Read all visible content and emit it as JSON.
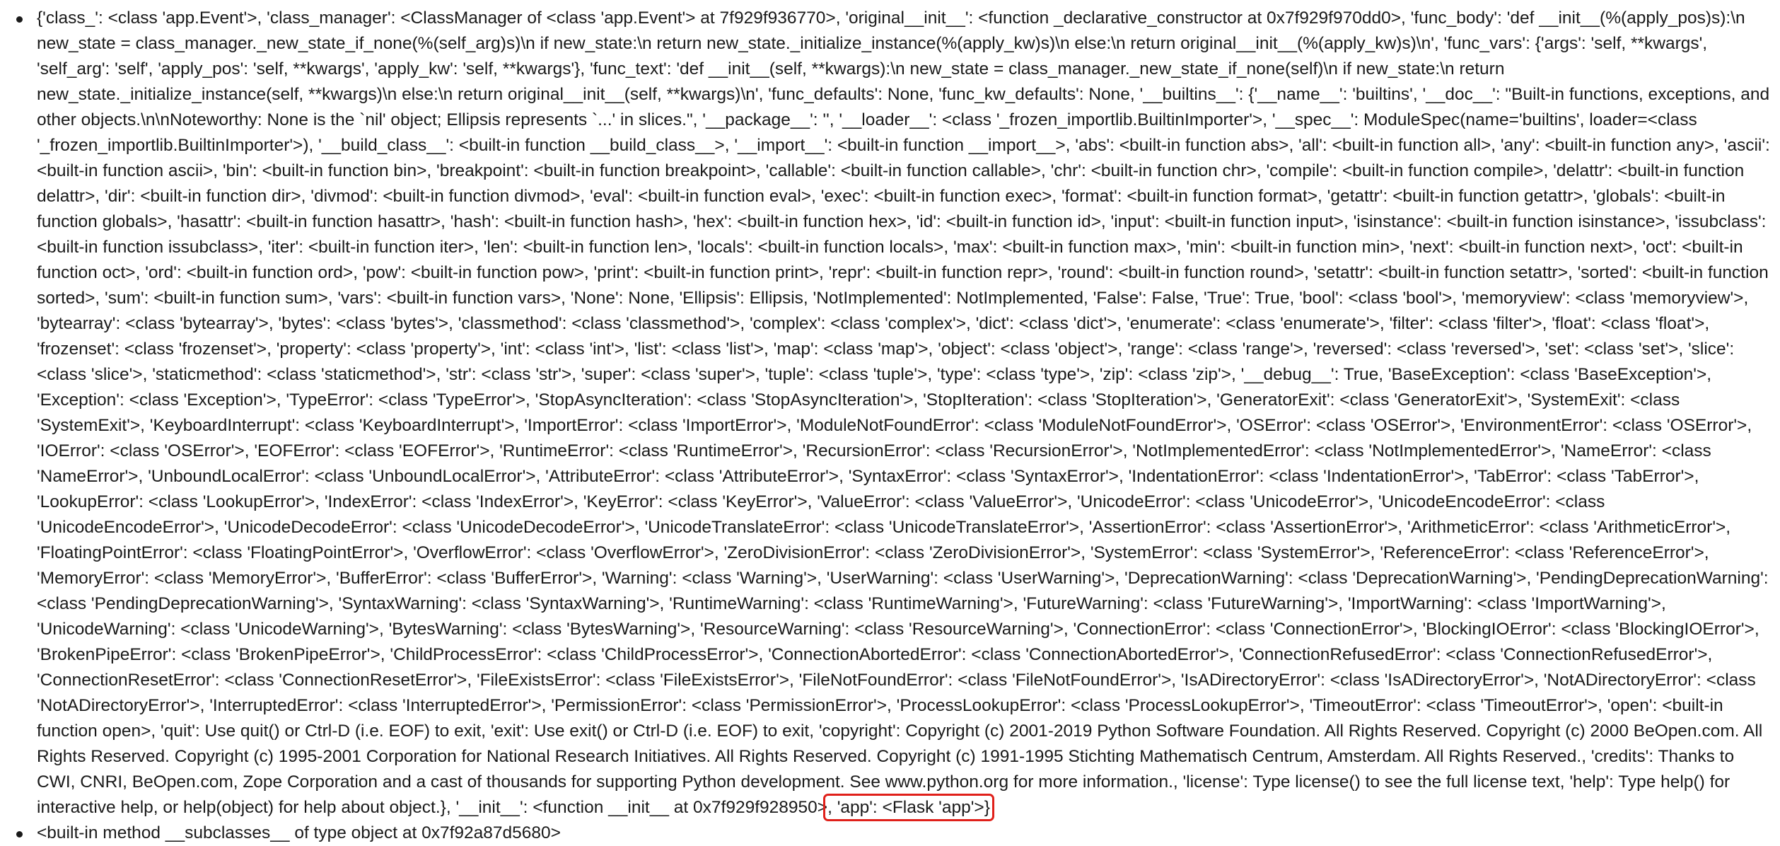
{
  "list": {
    "prev_item_text": "",
    "main_item_text": "{'class_': <class 'app.Event'>, 'class_manager': <ClassManager of <class 'app.Event'> at 7f929f936770>, 'original__init__': <function _declarative_constructor at 0x7f929f970dd0>, 'func_body': 'def __init__(%(apply_pos)s):\\n new_state = class_manager._new_state_if_none(%(self_arg)s)\\n if new_state:\\n return new_state._initialize_instance(%(apply_kw)s)\\n else:\\n return original__init__(%(apply_kw)s)\\n', 'func_vars': {'args': 'self, **kwargs', 'self_arg': 'self', 'apply_pos': 'self, **kwargs', 'apply_kw': 'self, **kwargs'}, 'func_text': 'def __init__(self, **kwargs):\\n new_state = class_manager._new_state_if_none(self)\\n if new_state:\\n return new_state._initialize_instance(self, **kwargs)\\n else:\\n return original__init__(self, **kwargs)\\n', 'func_defaults': None, 'func_kw_defaults': None, '__builtins__': {'__name__': 'builtins', '__doc__': \"Built-in functions, exceptions, and other objects.\\n\\nNoteworthy: None is the `nil' object; Ellipsis represents `...' in slices.\", '__package__': '', '__loader__': <class '_frozen_importlib.BuiltinImporter'>, '__spec__': ModuleSpec(name='builtins', loader=<class '_frozen_importlib.BuiltinImporter'>), '__build_class__': <built-in function __build_class__>, '__import__': <built-in function __import__>, 'abs': <built-in function abs>, 'all': <built-in function all>, 'any': <built-in function any>, 'ascii': <built-in function ascii>, 'bin': <built-in function bin>, 'breakpoint': <built-in function breakpoint>, 'callable': <built-in function callable>, 'chr': <built-in function chr>, 'compile': <built-in function compile>, 'delattr': <built-in function delattr>, 'dir': <built-in function dir>, 'divmod': <built-in function divmod>, 'eval': <built-in function eval>, 'exec': <built-in function exec>, 'format': <built-in function format>, 'getattr': <built-in function getattr>, 'globals': <built-in function globals>, 'hasattr': <built-in function hasattr>, 'hash': <built-in function hash>, 'hex': <built-in function hex>, 'id': <built-in function id>, 'input': <built-in function input>, 'isinstance': <built-in function isinstance>, 'issubclass': <built-in function issubclass>, 'iter': <built-in function iter>, 'len': <built-in function len>, 'locals': <built-in function locals>, 'max': <built-in function max>, 'min': <built-in function min>, 'next': <built-in function next>, 'oct': <built-in function oct>, 'ord': <built-in function ord>, 'pow': <built-in function pow>, 'print': <built-in function print>, 'repr': <built-in function repr>, 'round': <built-in function round>, 'setattr': <built-in function setattr>, 'sorted': <built-in function sorted>, 'sum': <built-in function sum>, 'vars': <built-in function vars>, 'None': None, 'Ellipsis': Ellipsis, 'NotImplemented': NotImplemented, 'False': False, 'True': True, 'bool': <class 'bool'>, 'memoryview': <class 'memoryview'>, 'bytearray': <class 'bytearray'>, 'bytes': <class 'bytes'>, 'classmethod': <class 'classmethod'>, 'complex': <class 'complex'>, 'dict': <class 'dict'>, 'enumerate': <class 'enumerate'>, 'filter': <class 'filter'>, 'float': <class 'float'>, 'frozenset': <class 'frozenset'>, 'property': <class 'property'>, 'int': <class 'int'>, 'list': <class 'list'>, 'map': <class 'map'>, 'object': <class 'object'>, 'range': <class 'range'>, 'reversed': <class 'reversed'>, 'set': <class 'set'>, 'slice': <class 'slice'>, 'staticmethod': <class 'staticmethod'>, 'str': <class 'str'>, 'super': <class 'super'>, 'tuple': <class 'tuple'>, 'type': <class 'type'>, 'zip': <class 'zip'>, '__debug__': True, 'BaseException': <class 'BaseException'>, 'Exception': <class 'Exception'>, 'TypeError': <class 'TypeError'>, 'StopAsyncIteration': <class 'StopAsyncIteration'>, 'StopIteration': <class 'StopIteration'>, 'GeneratorExit': <class 'GeneratorExit'>, 'SystemExit': <class 'SystemExit'>, 'KeyboardInterrupt': <class 'KeyboardInterrupt'>, 'ImportError': <class 'ImportError'>, 'ModuleNotFoundError': <class 'ModuleNotFoundError'>, 'OSError': <class 'OSError'>, 'EnvironmentError': <class 'OSError'>, 'IOError': <class 'OSError'>, 'EOFError': <class 'EOFError'>, 'RuntimeError': <class 'RuntimeError'>, 'RecursionError': <class 'RecursionError'>, 'NotImplementedError': <class 'NotImplementedError'>, 'NameError': <class 'NameError'>, 'UnboundLocalError': <class 'UnboundLocalError'>, 'AttributeError': <class 'AttributeError'>, 'SyntaxError': <class 'SyntaxError'>, 'IndentationError': <class 'IndentationError'>, 'TabError': <class 'TabError'>, 'LookupError': <class 'LookupError'>, 'IndexError': <class 'IndexError'>, 'KeyError': <class 'KeyError'>, 'ValueError': <class 'ValueError'>, 'UnicodeError': <class 'UnicodeError'>, 'UnicodeEncodeError': <class 'UnicodeEncodeError'>, 'UnicodeDecodeError': <class 'UnicodeDecodeError'>, 'UnicodeTranslateError': <class 'UnicodeTranslateError'>, 'AssertionError': <class 'AssertionError'>, 'ArithmeticError': <class 'ArithmeticError'>, 'FloatingPointError': <class 'FloatingPointError'>, 'OverflowError': <class 'OverflowError'>, 'ZeroDivisionError': <class 'ZeroDivisionError'>, 'SystemError': <class 'SystemError'>, 'ReferenceError': <class 'ReferenceError'>, 'MemoryError': <class 'MemoryError'>, 'BufferError': <class 'BufferError'>, 'Warning': <class 'Warning'>, 'UserWarning': <class 'UserWarning'>, 'DeprecationWarning': <class 'DeprecationWarning'>, 'PendingDeprecationWarning': <class 'PendingDeprecationWarning'>, 'SyntaxWarning': <class 'SyntaxWarning'>, 'RuntimeWarning': <class 'RuntimeWarning'>, 'FutureWarning': <class 'FutureWarning'>, 'ImportWarning': <class 'ImportWarning'>, 'UnicodeWarning': <class 'UnicodeWarning'>, 'BytesWarning': <class 'BytesWarning'>, 'ResourceWarning': <class 'ResourceWarning'>, 'ConnectionError': <class 'ConnectionError'>, 'BlockingIOError': <class 'BlockingIOError'>, 'BrokenPipeError': <class 'BrokenPipeError'>, 'ChildProcessError': <class 'ChildProcessError'>, 'ConnectionAbortedError': <class 'ConnectionAbortedError'>, 'ConnectionRefusedError': <class 'ConnectionRefusedError'>, 'ConnectionResetError': <class 'ConnectionResetError'>, 'FileExistsError': <class 'FileExistsError'>, 'FileNotFoundError': <class 'FileNotFoundError'>, 'IsADirectoryError': <class 'IsADirectoryError'>, 'NotADirectoryError': <class 'NotADirectoryError'>, 'InterruptedError': <class 'InterruptedError'>, 'PermissionError': <class 'PermissionError'>, 'ProcessLookupError': <class 'ProcessLookupError'>, 'TimeoutError': <class 'TimeoutError'>, 'open': <built-in function open>, 'quit': Use quit() or Ctrl-D (i.e. EOF) to exit, 'exit': Use exit() or Ctrl-D (i.e. EOF) to exit, 'copyright': Copyright (c) 2001-2019 Python Software Foundation. All Rights Reserved. Copyright (c) 2000 BeOpen.com. All Rights Reserved. Copyright (c) 1995-2001 Corporation for National Research Initiatives. All Rights Reserved. Copyright (c) 1991-1995 Stichting Mathematisch Centrum, Amsterdam. All Rights Reserved., 'credits': Thanks to CWI, CNRI, BeOpen.com, Zope Corporation and a cast of thousands for supporting Python development. See www.python.org for more information., 'license': Type license() to see the full license text, 'help': Type help() for interactive help, or help(object) for help about object.}, '__init__': <function __init__ at 0x7f929f928950>",
    "highlighted_text": ", 'app': <Flask 'app'>}",
    "next_item_text": "<built-in method __subclasses__ of type object at 0x7f92a87d5680>"
  },
  "colors": {
    "highlight_border": "#e0201a",
    "text": "#1a1a1a",
    "background": "#ffffff"
  }
}
